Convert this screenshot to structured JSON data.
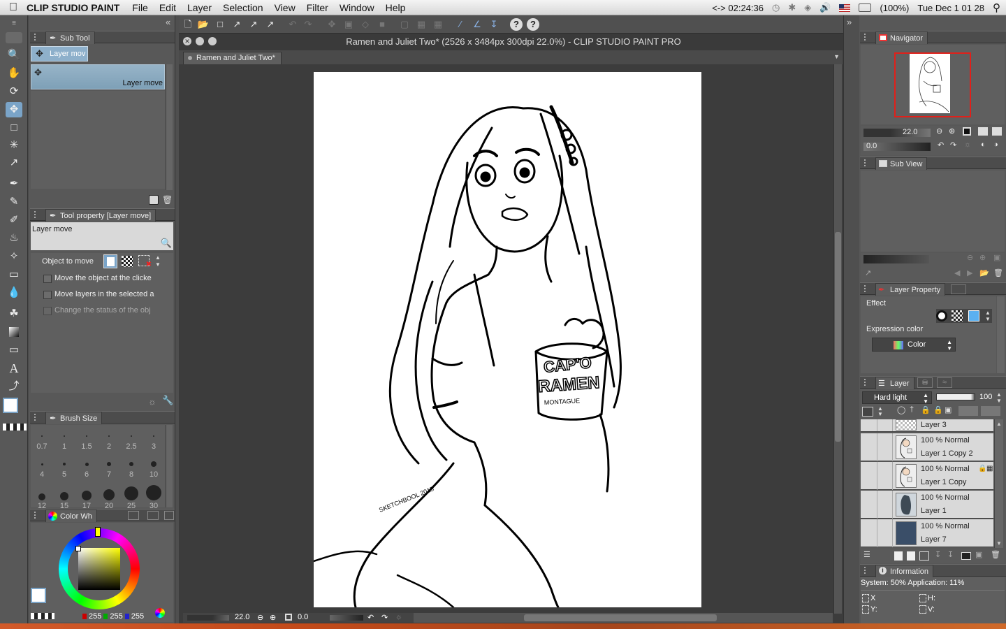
{
  "menubar": {
    "app_name": "CLIP STUDIO PAINT",
    "items": [
      "File",
      "Edit",
      "Layer",
      "Selection",
      "View",
      "Filter",
      "Window",
      "Help"
    ],
    "clock": "<-> 02:24:36",
    "battery": "(100%)",
    "datetime": "Tue Dec 1  01 28"
  },
  "subtool": {
    "title": "Sub Tool",
    "selected_tab": "Layer mov",
    "item_label": "Layer move"
  },
  "tool_property": {
    "title": "Tool property [Layer move]",
    "tool_name": "Layer move",
    "object_to_move_label": "Object to move",
    "options": [
      "Move the object at the clicke",
      "Move layers in the selected a",
      "Change the status of the obj"
    ]
  },
  "brush_size": {
    "title": "Brush Size",
    "sizes": [
      "0.7",
      "1",
      "1.5",
      "2",
      "2.5",
      "3",
      "4",
      "5",
      "6",
      "7",
      "8",
      "10",
      "12",
      "15",
      "17",
      "20",
      "25",
      "30"
    ]
  },
  "color_wheel": {
    "title": "Color Wh",
    "r": "255",
    "g": "255",
    "b": "255"
  },
  "document": {
    "title": "Ramen and Juliet Two* (2526 x 3484px 300dpi 22.0%)  - CLIP STUDIO PAINT PRO",
    "tab_label": "Ramen and Juliet Two*",
    "zoom": "22.0",
    "angle": "0.0",
    "artwork_text": {
      "cup_line1": "CAP'O",
      "cup_line2": "RAMEN",
      "cup_line3": "MONTAGUE",
      "signature": "SKETCHBOOL 2015"
    }
  },
  "navigator": {
    "title": "Navigator",
    "zoom": "22.0",
    "angle": "0.0"
  },
  "subview": {
    "title": "Sub View"
  },
  "layer_property": {
    "title": "Layer Property",
    "effect_label": "Effect",
    "expression_color_label": "Expression color",
    "expression_color_value": "Color"
  },
  "layer_panel": {
    "title": "Layer",
    "blend_mode": "Hard light",
    "opacity": "100",
    "layers": [
      {
        "mode": "100 % Normal",
        "name": "Layer 1 Copy 2"
      },
      {
        "mode": "100 % Normal",
        "name": "Layer 1 Copy"
      },
      {
        "mode": "100 % Normal",
        "name": "Layer 1"
      },
      {
        "mode": "100 % Normal",
        "name": "Layer 7"
      }
    ],
    "partial_layer": "Layer 3"
  },
  "information": {
    "title": "Information",
    "system": "System: 50% Application: 11%",
    "x": "X",
    "y": "Y:",
    "h": "H:",
    "v": "V:"
  },
  "colors": {
    "accent_blue": "#7aa4c8",
    "nav_frame": "#e0201a",
    "panel": "#585858",
    "canvas_bg": "#3c3c3c"
  }
}
